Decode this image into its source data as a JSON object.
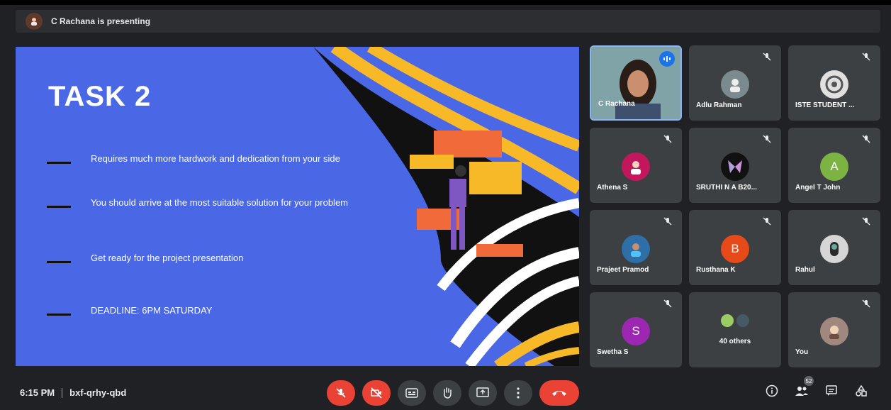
{
  "presenting": {
    "text": "C Rachana is presenting"
  },
  "slide": {
    "title": "TASK 2",
    "bullets": [
      "Requires much more hardwork and dedication from your side",
      "You should arrive at the most suitable solution for your problem",
      "Get ready for the project presentation",
      "DEADLINE: 6PM SATURDAY"
    ],
    "colors": {
      "background": "#4a67e6",
      "stripe_yellow": "#f7b928",
      "stripe_black": "#111111"
    }
  },
  "participants": [
    {
      "name": "C Rachana",
      "kind": "video",
      "speaking": true
    },
    {
      "name": "Adlu Rahman",
      "kind": "photo",
      "avatar_color": "#7b8a8e"
    },
    {
      "name": "ISTE STUDENT ...",
      "kind": "photo",
      "avatar_color": "#5a5a5a"
    },
    {
      "name": "Athena S",
      "kind": "photo",
      "avatar_color": "#c2185b"
    },
    {
      "name": "SRUTHI N A B20...",
      "kind": "photo",
      "avatar_color": "#7e57c2"
    },
    {
      "name": "Angel T John",
      "kind": "letter",
      "letter": "A",
      "avatar_color": "#7cb342"
    },
    {
      "name": "Prajeet Pramod",
      "kind": "photo",
      "avatar_color": "#2e6fa8"
    },
    {
      "name": "Rusthana K",
      "kind": "letter",
      "letter": "B",
      "avatar_color": "#e64a19"
    },
    {
      "name": "Rahul",
      "kind": "photo",
      "avatar_color": "#d6d6d6"
    },
    {
      "name": "Swetha S",
      "kind": "letter",
      "letter": "S",
      "avatar_color": "#9c27b0"
    },
    {
      "name": "40 others",
      "kind": "group"
    },
    {
      "name": "You",
      "kind": "photo",
      "avatar_color": "#a1887f"
    }
  ],
  "bottom": {
    "time": "6:15 PM",
    "meeting_code": "bxf-qrhy-qbd",
    "participant_count": "52",
    "controls": [
      "mic-off",
      "camera-off",
      "captions",
      "raise-hand",
      "present",
      "more",
      "end-call"
    ]
  }
}
